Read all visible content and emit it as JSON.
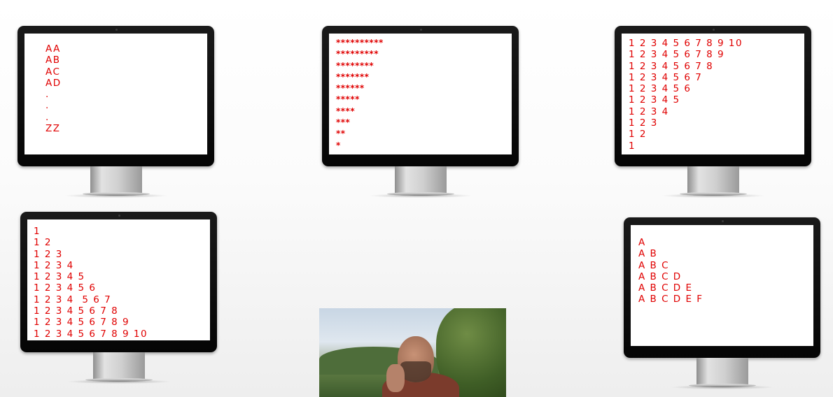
{
  "monitors": {
    "aa_zz": {
      "lines": [
        "AA",
        "AB",
        "AC",
        "AD",
        ".",
        ".",
        ".",
        "ZZ"
      ]
    },
    "stars": {
      "lines": [
        "**********",
        "*********",
        "********",
        "*******",
        "******",
        "*****",
        "****",
        "***",
        "**",
        "*"
      ]
    },
    "numbers_desc": {
      "lines": [
        "1 2 3 4 5 6 7 8 9 10",
        "1 2 3 4 5 6 7 8 9",
        "1 2 3 4 5 6 7 8",
        "1 2 3 4 5 6 7",
        "1 2 3 4 5 6",
        "1 2 3 4 5",
        "1 2 3 4",
        "1 2 3",
        "1 2",
        "1"
      ]
    },
    "numbers_asc": {
      "lines": [
        "1",
        "1 2",
        "1 2 3",
        "1 2 3 4",
        "1 2 3 4 5",
        "1 2 3 4 5 6",
        "1 2 3 4  5 6 7",
        "1 2 3 4 5 6 7 8",
        "1 2 3 4 5 6 7 8 9",
        "1 2 3 4 5 6 7 8 9 10"
      ]
    },
    "letters": {
      "lines": [
        "A",
        "A B",
        "A B C",
        "A B C D",
        "A B C D E",
        "A B C D E F"
      ]
    }
  },
  "colors": {
    "text": "#e00000",
    "bezel": "#0b0b0b",
    "screen": "#ffffff"
  },
  "webcam": {
    "icon": "person-video-feed"
  }
}
